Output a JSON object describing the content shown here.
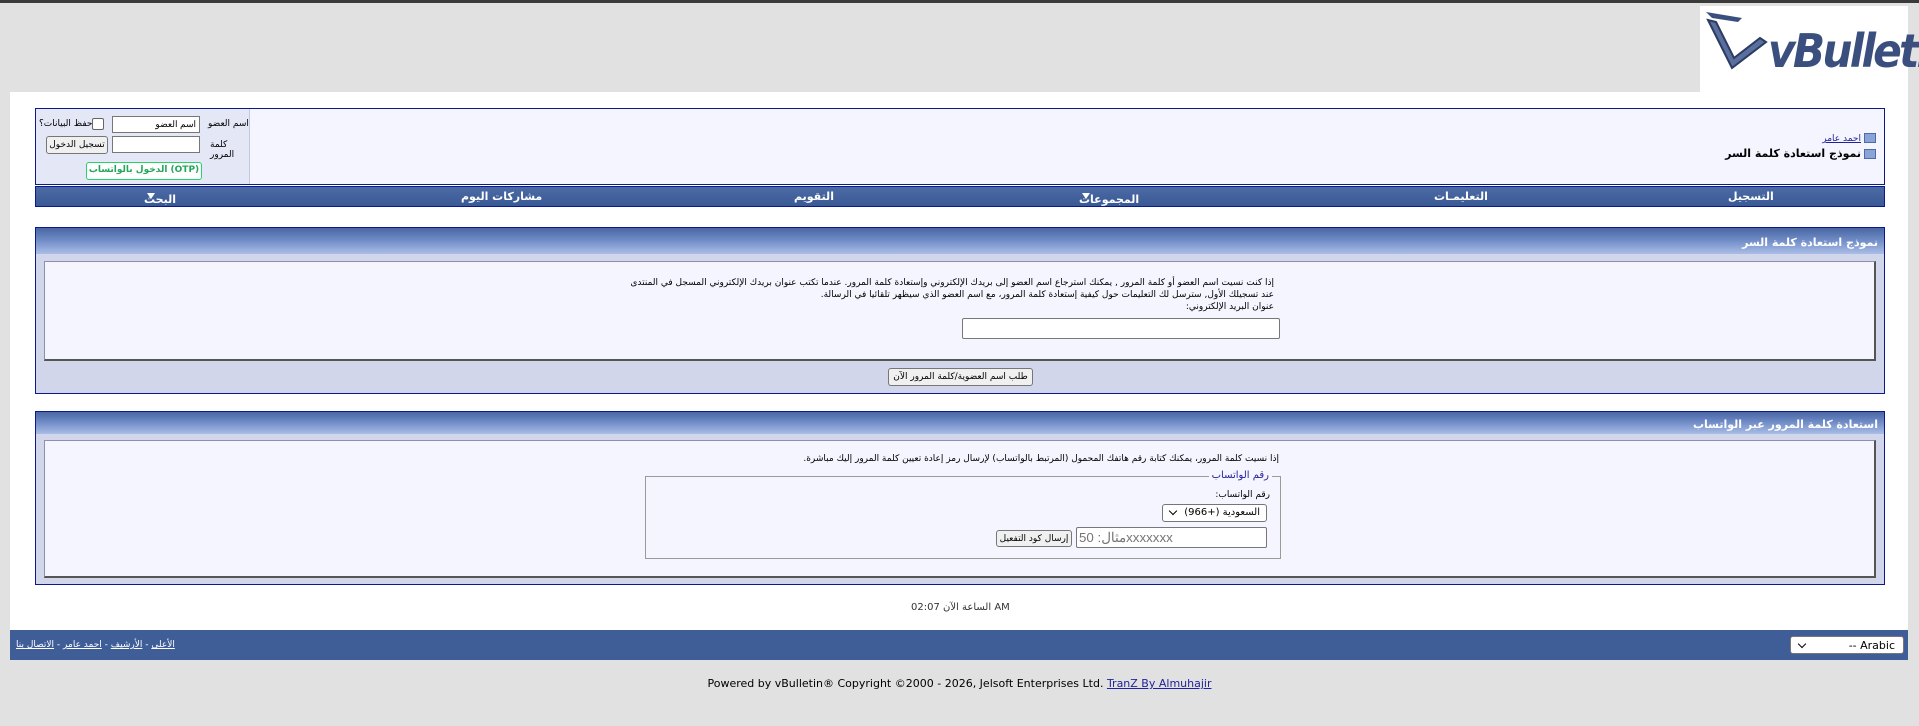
{
  "logo": {
    "text": "vBulletin"
  },
  "breadcrumb": {
    "link": "احمد عامر",
    "title": "نموذج استعادة كلمة السر"
  },
  "login": {
    "username_label": "اسم العضو",
    "username_value": "اسم العضو",
    "password_label": "كلمة المرور",
    "remember_label": "حفظ البيانات؟",
    "login_button": "تسجيل الدخول",
    "otp_button": "الدخول بالواتساب (OTP)"
  },
  "nav": {
    "register": "التسجيل",
    "help": "التعليمـات",
    "groups": "المجموعات",
    "calendar": "التقويم",
    "today_posts": "مشاركات اليوم",
    "search": "البحث"
  },
  "recovery": {
    "title": "نموذج استعادة كلمة السر",
    "text_line1": "إذا كنت نسيت اسم العضو أو كلمة المرور , يمكنك استرجاع اسم العضو إلى بريدك الإلكتروني وإستعادة كلمة المرور. عندما تكتب عنوان بريدك الإلكتروني المسجل في المنتدى",
    "text_line2": "عند تسجيلك الأول, سترسل لك التعليمات حول كيفية إستعادة كلمة المرور، مع اسم العضو الذي سيظهر تلقائيا في الرسالة.",
    "email_label": "عنوان البريد الإلكتروني:",
    "submit_button": "طلب اسم العضوية/كلمة المرور الآن"
  },
  "whatsapp": {
    "title": "استعادة كلمة المرور عبر الواتساب",
    "text": "إذا نسيت كلمة المرور، يمكنك كتابة رقم هاتفك المحمول (المرتبط بالواتساب) لإرسال رمز إعادة تعيين كلمة المرور إليك مباشرة.",
    "legend": "رقم الواتساب",
    "number_label": "رقم الواتساب:",
    "country_selected": "السعودية (+966)",
    "phone_placeholder": "مثال: 50xxxxxxx",
    "send_button": "إرسال كود التفعيل"
  },
  "footer": {
    "time_label": "الساعة الآن 02:07 AM",
    "links": [
      "الاتصال بنا",
      "احمد عامر",
      "الأرشيف",
      "الأعلى"
    ],
    "language_selected": "-- Arabic",
    "powered_text": "Powered by vBulletin® Copyright ©2000 - 2026, Jelsoft Enterprises Ltd.",
    "powered_link": "TranZ By Almuhajir"
  },
  "colors": {
    "navbar": "#3f5e97",
    "border": "#0b198c",
    "panel_bg": "#f5f5ff",
    "otp_green": "#25d366"
  }
}
